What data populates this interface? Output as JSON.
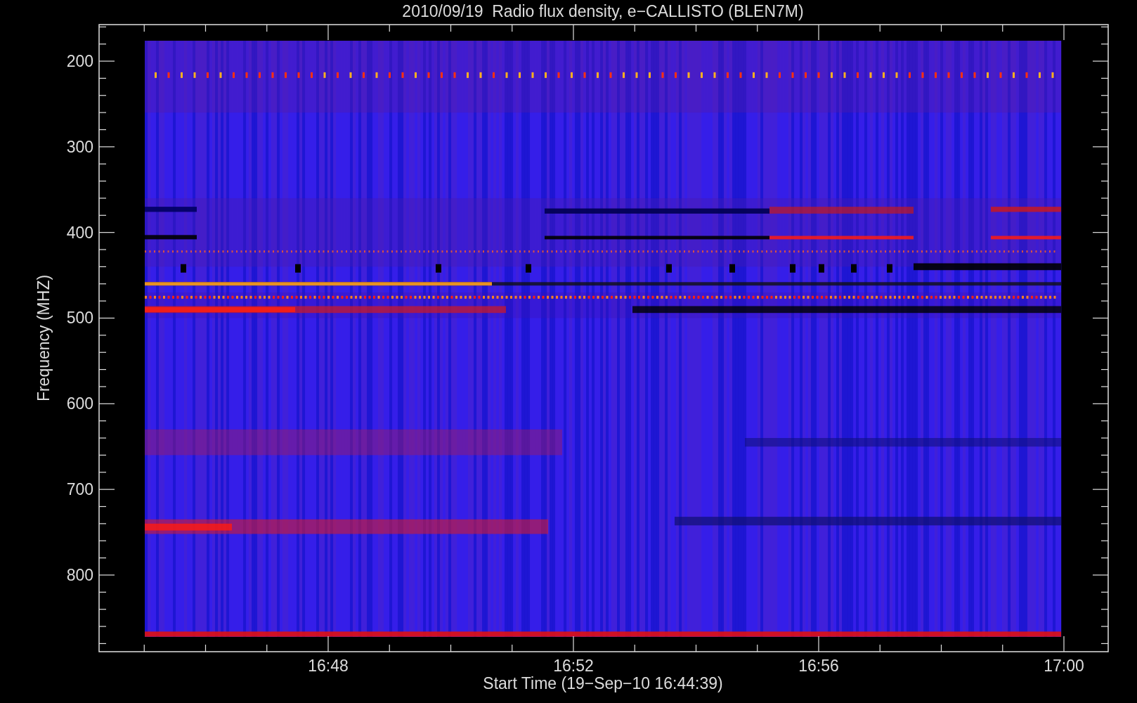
{
  "title": "2010/09/19  Radio flux density, e−CALLISTO (BLEN7M)",
  "y_axis": {
    "label": "Frequency (MHZ)",
    "ticks": [
      "200",
      "300",
      "400",
      "500",
      "600",
      "700",
      "800"
    ]
  },
  "x_axis": {
    "label": "Start Time (19−Sep−10 16:44:39)",
    "ticks": [
      "16:48",
      "16:52",
      "16:56",
      "17:00"
    ]
  }
}
